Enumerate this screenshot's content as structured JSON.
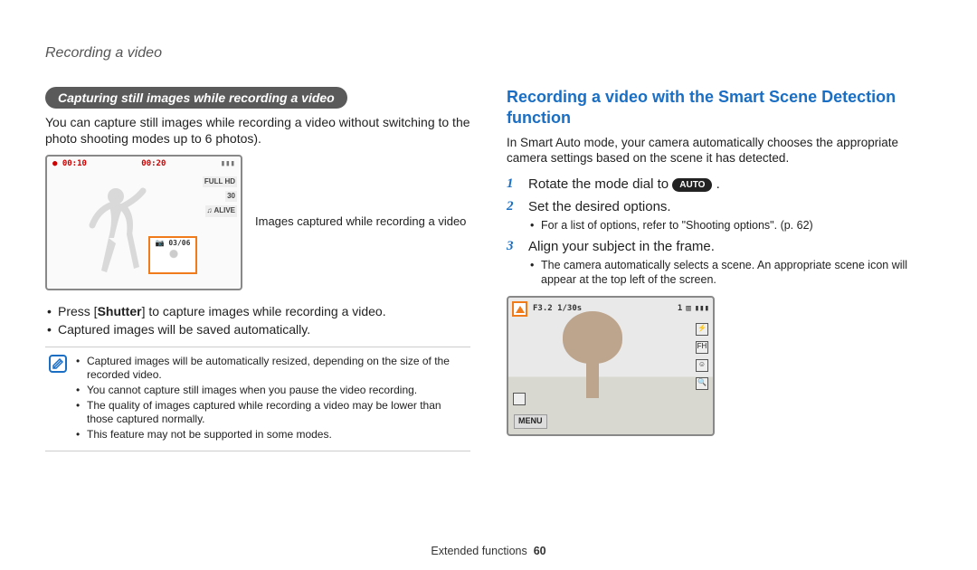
{
  "header": {
    "title": "Recording a video"
  },
  "left": {
    "pill": "Capturing still images while recording a video",
    "intro": "You can capture still images while recording a video without switching to the photo shooting modes up to 6 photos).",
    "screen": {
      "rec_time": "● 00:10",
      "remain": "00:20",
      "battery_icon": "battery",
      "right_badges": [
        "FULL HD",
        "30",
        "♫ ALIVE"
      ],
      "thumb_label": "📷 03/06"
    },
    "caption": "Images captured while recording a video",
    "bullets": [
      "Press [Shutter] to capture images while recording a video.",
      "Captured images will be saved automatically."
    ],
    "notes": [
      "Captured images will be automatically resized, depending on the size of the recorded video.",
      "You cannot capture still images when you pause the video recording.",
      "The quality of images captured while recording a video may be lower than those captured normally.",
      "This feature may not be supported in some modes."
    ]
  },
  "right": {
    "heading": "Recording a video with the Smart Scene Detection function",
    "intro": "In Smart Auto mode, your camera automatically chooses the appropriate camera settings based on the scene it has detected.",
    "auto_label": "AUTO",
    "steps": [
      {
        "n": "1",
        "text_pre": "Rotate the mode dial to ",
        "text_post": "."
      },
      {
        "n": "2",
        "text": "Set the desired options.",
        "sub": "For a list of options, refer to \"Shooting options\". (p. 62)"
      },
      {
        "n": "3",
        "text": "Align your subject in the frame.",
        "sub": "The camera automatically selects a scene. An appropriate scene icon will appear at the top left of the screen."
      }
    ],
    "screen": {
      "exposure": "F3.2  1/30s",
      "counter": "1",
      "menu": "MENU"
    }
  },
  "footer": {
    "section": "Extended functions",
    "page": "60"
  }
}
